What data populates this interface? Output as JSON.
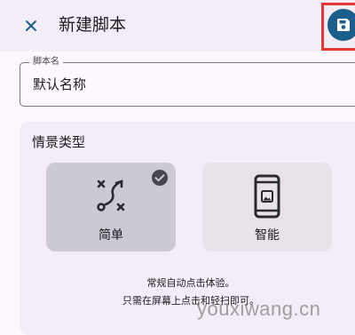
{
  "header": {
    "title": "新建脚本",
    "close_icon": "close-icon",
    "save_icon": "save-icon",
    "accent_color": "#1b5e8b"
  },
  "name_field": {
    "label": "脚本名",
    "value": "默认名称"
  },
  "scene": {
    "title": "情景类型",
    "options": [
      {
        "label": "简单",
        "icon": "gesture-path-icon",
        "selected": true
      },
      {
        "label": "智能",
        "icon": "phone-image-icon",
        "selected": false
      }
    ],
    "description_line1": "常规自动点击体验。",
    "description_line2": "只需在屏幕上点击和轻扫即可。"
  },
  "watermark": "youxiwang.cn"
}
